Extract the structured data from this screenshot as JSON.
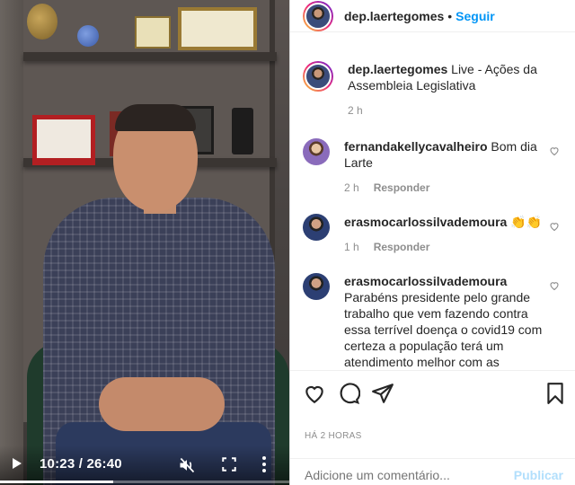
{
  "video": {
    "time_label": "10:23 / 26:40",
    "progress": 0.39,
    "icons": [
      "play-icon",
      "mute-icon",
      "fullscreen-icon",
      "more-options-icon"
    ]
  },
  "header": {
    "username": "dep.laertegomes",
    "separator": "•",
    "follow_label": "Seguir"
  },
  "caption": {
    "username": "dep.laertegomes",
    "text": "Live - Ações da Assembleia Legislativa",
    "time": "2 h"
  },
  "comments": [
    {
      "username": "fernandakellycavalheiro",
      "text": "Bom dia Larte",
      "time": "2 h",
      "reply_label": "Responder",
      "avatar_color": "#8a6bbb"
    },
    {
      "username": "erasmocarlossilvademoura",
      "text": "👏👏",
      "time": "1 h",
      "reply_label": "Responder",
      "avatar_color": "#2c3f73"
    },
    {
      "username": "erasmocarlossilvademoura",
      "text": "Parabéns presidente pelo grande trabalho que vem fazendo contra essa terrível doença o covid19 com certeza a população terá um atendimento melhor com as",
      "time": "",
      "reply_label": "",
      "avatar_color": "#2c3f73"
    }
  ],
  "actions": [
    "heart-icon",
    "comment-icon",
    "share-icon",
    "bookmark-icon"
  ],
  "date_label": "HÁ 2 HORAS",
  "comment_box": {
    "placeholder": "Adicione um comentário...",
    "publish_label": "Publicar"
  }
}
